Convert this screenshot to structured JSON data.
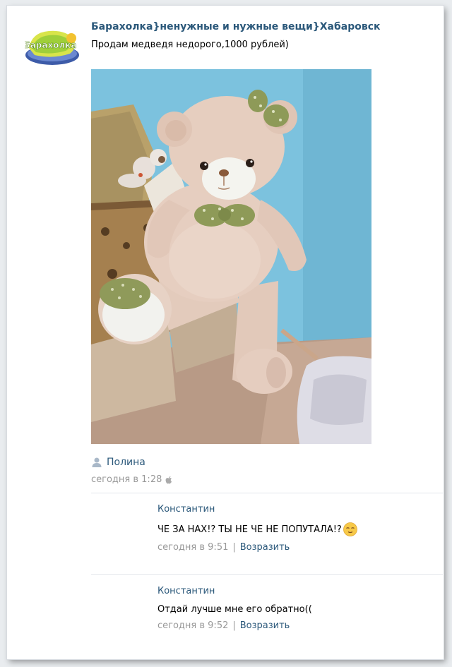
{
  "post": {
    "group_name": "Барахолка}ненужные и нужные вещи}Хабаровск",
    "text": "Продам медведя недорого,1000 рублей)",
    "photo_alt": "Плюшевый медведь",
    "author": "Полина",
    "time": "сегодня в 1:28",
    "platform_icon": "apple-icon"
  },
  "comments": [
    {
      "author": "Константин",
      "text": "ЧЕ ЗА НАХ!? ТЫ НЕ ЧЕ НЕ ПОПУТАЛА!?",
      "emoji": "relieved-face-emoji",
      "time": "сегодня в 9:51",
      "separator": "|",
      "reply_label": "Возразить"
    },
    {
      "author": "Константин",
      "text": "Отдай лучше мне его обратно((",
      "time": "сегодня в 9:52",
      "separator": "|",
      "reply_label": "Возразить"
    }
  ],
  "colors": {
    "link": "#2b587a",
    "meta": "#999999",
    "wall": "#7ec3de"
  }
}
